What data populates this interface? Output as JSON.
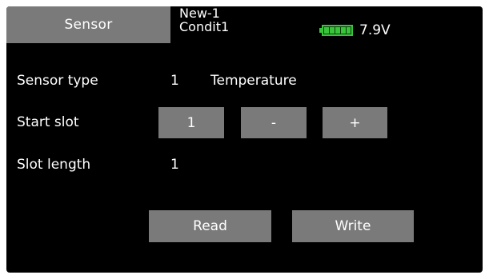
{
  "header": {
    "title": "Sensor",
    "model_name": "New-1",
    "condition": "Condit1",
    "battery": {
      "voltage": "7.9V",
      "level": 1.0,
      "color": "#39c43b"
    }
  },
  "rows": {
    "sensor_type": {
      "label": "Sensor type",
      "number": "1",
      "name": "Temperature"
    },
    "start_slot": {
      "label": "Start slot",
      "value": "1",
      "minus": "-",
      "plus": "+"
    },
    "slot_length": {
      "label": "Slot length",
      "value": "1"
    }
  },
  "actions": {
    "read": "Read",
    "write": "Write"
  },
  "colors": {
    "background": "#000000",
    "button": "#7a7a7a",
    "text": "#ffffff"
  }
}
